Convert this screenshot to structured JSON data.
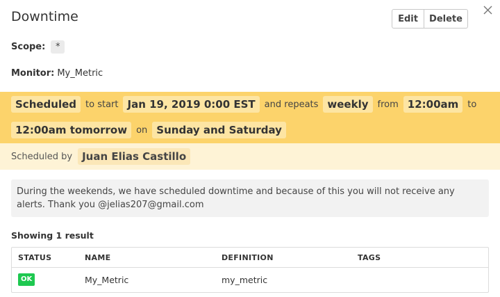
{
  "header": {
    "title": "Downtime",
    "edit_label": "Edit",
    "delete_label": "Delete",
    "close_icon": "close-icon"
  },
  "scope": {
    "label": "Scope:",
    "value": "*"
  },
  "monitor": {
    "label": "Monitor:",
    "value": "My_Metric"
  },
  "schedule": {
    "status": "Scheduled",
    "to_start_text": "to start",
    "start": "Jan 19, 2019 0:00 EST",
    "and_repeats_text": "and repeats",
    "repeat": "weekly",
    "from_text": "from",
    "from_time": "12:00am",
    "to_text": "to",
    "to_time": "12:00am tomorrow",
    "on_text": "on",
    "days": "Sunday and Saturday",
    "band_color": "#fcd36b"
  },
  "scheduled_by": {
    "label": "Scheduled by",
    "name": "Juan Elias Castillo"
  },
  "message": "During the weekends, we have scheduled downtime and because of this you will not receive any alerts. Thank you @jelias207@gmail.com",
  "results": {
    "showing": "Showing 1 result",
    "columns": [
      "STATUS",
      "NAME",
      "DEFINITION",
      "TAGS"
    ],
    "rows": [
      {
        "status": "OK",
        "name": "My_Metric",
        "definition": "my_metric",
        "tags": ""
      }
    ],
    "ok_color": "#1ec850"
  }
}
